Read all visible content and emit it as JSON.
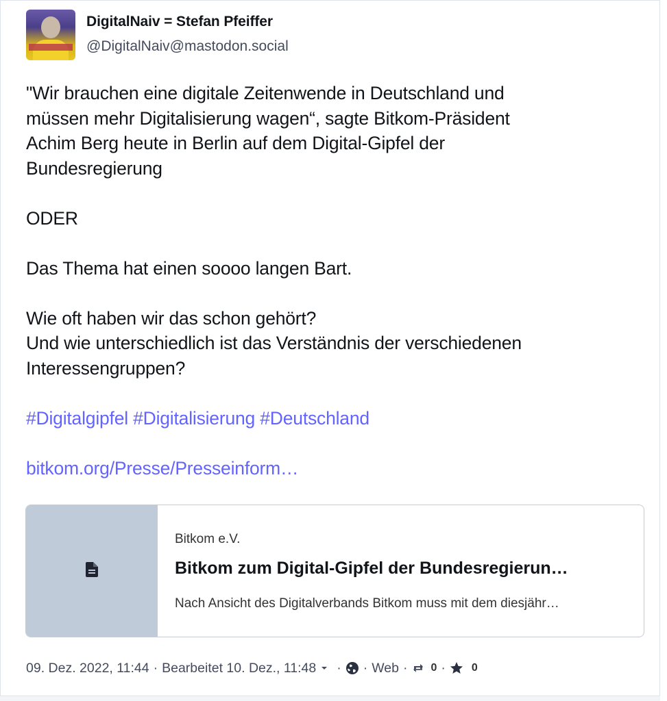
{
  "post": {
    "author": {
      "display_name": "DigitalNaiv = Stefan Pfeiffer",
      "handle": "@DigitalNaiv@mastodon.social"
    },
    "paragraphs": {
      "p1_line1": "\"Wir brauchen eine digitale Zeitenwende in Deutschland und",
      "p1_line2": "müssen mehr Digitalisierung wagen“, sagte Bitkom-Präsident",
      "p1_line3": "Achim Berg heute in Berlin auf dem Digital-Gipfel der",
      "p1_line4": "Bundesregierung",
      "p2": "ODER",
      "p3": "Das Thema hat einen soooo langen Bart.",
      "p4_line1": "Wie oft haben wir das schon gehört?",
      "p4_line2": "Und wie unterschiedlich ist das Verständnis der verschiedenen",
      "p4_line3": "Interessengruppen?"
    },
    "hashtags": [
      "#Digitalgipfel",
      "#Digitalisierung",
      "#Deutschland"
    ],
    "link_text": "bitkom.org/Presse/Presseinform…",
    "card": {
      "provider": "Bitkom e.V.",
      "title": "Bitkom zum Digital-Gipfel der Bundesregierun…",
      "description": "Nach Ansicht des Digitalverbands Bitkom muss mit dem diesjähr…",
      "thumbnail_icon": "document-icon"
    },
    "meta": {
      "posted": "09. Dez. 2022, 11:44",
      "edited": "Bearbeitet 10. Dez., 11:48",
      "visibility_icon": "globe-icon",
      "application": "Web",
      "boosts": "0",
      "favourites": "0"
    }
  },
  "colors": {
    "link": "#6364ff",
    "text": "#111418",
    "muted": "#444b5d",
    "card_thumb_bg": "#c0cbd9"
  }
}
